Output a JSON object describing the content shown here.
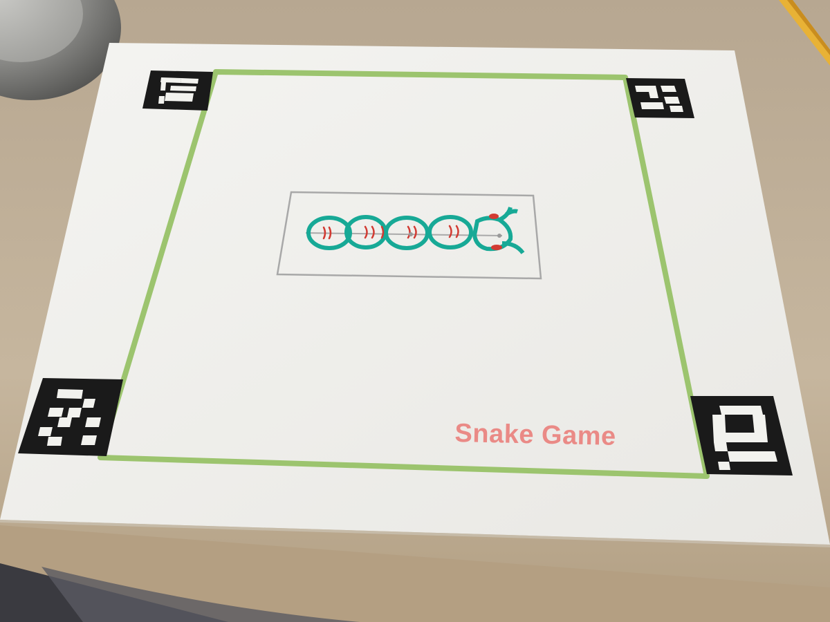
{
  "paper": {
    "caption": "Snake Game",
    "caption_color": "#ea8a86"
  },
  "colors": {
    "border_green": "#9cc46e",
    "snake_teal": "#17a996",
    "snake_red": "#d23a32",
    "marker_black": "#1a1a1a",
    "frame_gray": "#a8a8a8"
  },
  "markers": [
    {
      "name": "marker-top-left-icon"
    },
    {
      "name": "marker-top-right-icon"
    },
    {
      "name": "marker-bottom-left-icon"
    },
    {
      "name": "marker-bottom-right-icon"
    }
  ],
  "snake": {
    "segments": 5
  }
}
